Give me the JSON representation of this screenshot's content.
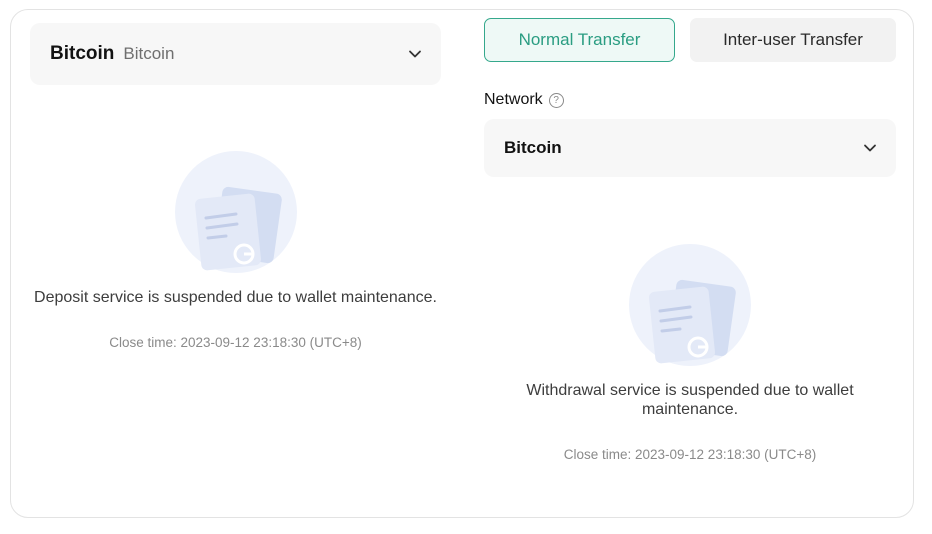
{
  "deposit": {
    "coin_symbol": "Bitcoin",
    "coin_name": "Bitcoin",
    "message": "Deposit service is suspended due to wallet maintenance.",
    "close_time": "Close time: 2023-09-12 23:18:30 (UTC+8)"
  },
  "withdraw": {
    "tabs": [
      {
        "label": "Normal Transfer",
        "active": true
      },
      {
        "label": "Inter-user Transfer",
        "active": false
      }
    ],
    "network_label": "Network",
    "network_value": "Bitcoin",
    "message": "Withdrawal service is suspended due to wallet maintenance.",
    "close_time": "Close time: 2023-09-12 23:18:30 (UTC+8)"
  },
  "icons": [
    "chevron-down-icon",
    "help-circle-icon",
    "empty-document-icon"
  ],
  "colors": {
    "accent": "#35a88c",
    "accent_text": "#2a9d82",
    "accent_bg": "#eef9f6",
    "field_bg": "#f7f7f7",
    "muted_text": "#8a8a8a"
  }
}
